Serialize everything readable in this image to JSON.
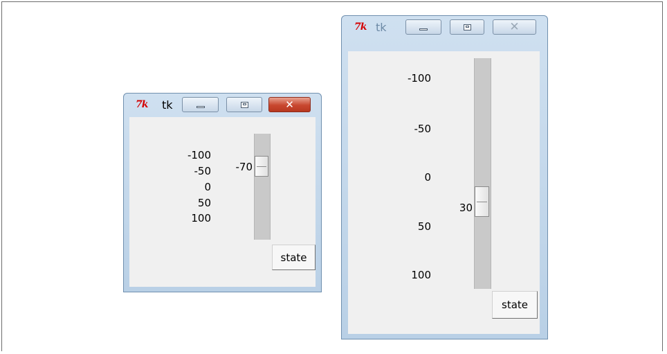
{
  "window_small": {
    "title": "tk",
    "icon": "tk-feather-icon",
    "close_color": "#c8472f",
    "scale": {
      "ticks": [
        "-100",
        "-50",
        "0",
        "50",
        "100"
      ],
      "range": [
        -100,
        100
      ],
      "value": -70,
      "value_label": "-70"
    },
    "state_button": "state"
  },
  "window_large": {
    "title": "tk",
    "icon": "tk-feather-icon",
    "scale": {
      "ticks": [
        "-100",
        "-50",
        "0",
        "50",
        "100"
      ],
      "range": [
        -100,
        100
      ],
      "value": 30,
      "value_label": "30"
    },
    "state_button": "state"
  }
}
